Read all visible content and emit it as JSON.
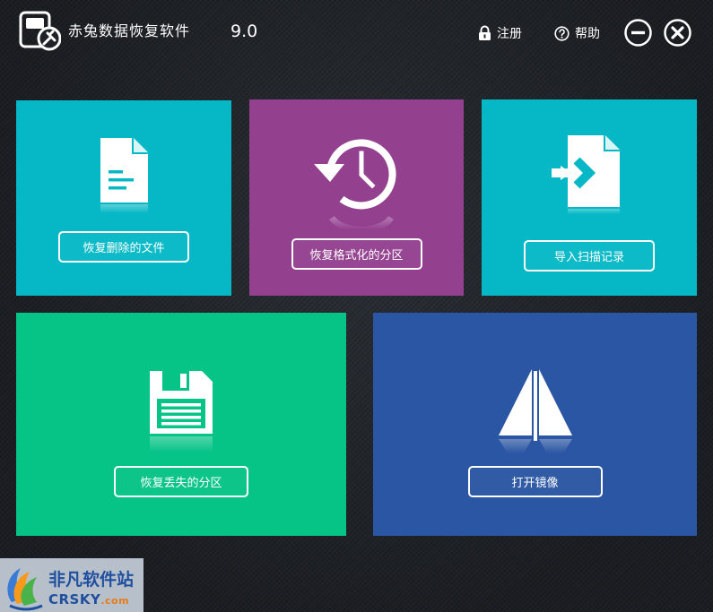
{
  "window": {
    "title": "赤兔数据恢复软件",
    "version": "9.0"
  },
  "header": {
    "register_label": "注册",
    "help_label": "帮助"
  },
  "tiles": [
    {
      "id": "recover-deleted",
      "label": "恢复删除的文件",
      "icon": "document-icon",
      "color": "#06b8c6"
    },
    {
      "id": "recover-formatted",
      "label": "恢复格式化的分区",
      "icon": "history-clock-icon",
      "color": "#93408f"
    },
    {
      "id": "import-scan",
      "label": "导入扫描记录",
      "icon": "import-file-icon",
      "color": "#06b8c6"
    },
    {
      "id": "recover-lost",
      "label": "恢复丢失的分区",
      "icon": "floppy-disk-icon",
      "color": "#06c386"
    },
    {
      "id": "open-image",
      "label": "打开镜像",
      "icon": "sailboat-icon",
      "color": "#2b56a3"
    }
  ],
  "watermark": {
    "line1": "非凡软件站",
    "line2": "CRSKY",
    "line2_suffix": ".com"
  }
}
